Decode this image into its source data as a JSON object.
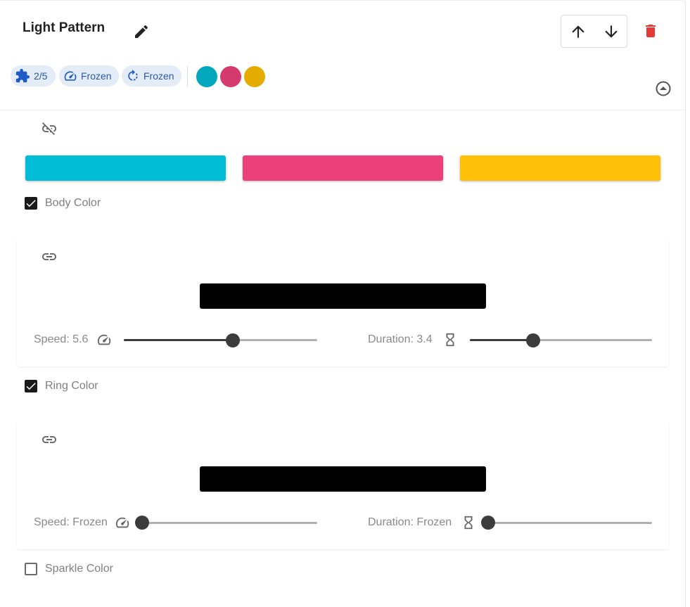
{
  "header": {
    "title": "Light Pattern"
  },
  "chips": [
    {
      "icon": "puzzle-icon",
      "label": "2/5"
    },
    {
      "icon": "speedometer-icon",
      "label": "Frozen"
    },
    {
      "icon": "rotate-icon",
      "label": "Frozen"
    }
  ],
  "palette": {
    "dots": [
      "#00a8be",
      "#d43a6e",
      "#e5ac00"
    ],
    "bars": [
      "#00bcd4",
      "#ec407a",
      "#ffc107"
    ]
  },
  "sections": [
    {
      "label": "Body Color",
      "checked": true,
      "speed_label": "Speed: 5.6",
      "speed_value": 5.6,
      "duration_label": "Duration: 3.4",
      "duration_value": 3.4
    },
    {
      "label": "Ring Color",
      "checked": true,
      "speed_label": "Speed: Frozen",
      "duration_label": "Duration: Frozen"
    },
    {
      "label": "Sparkle Color",
      "checked": false
    }
  ],
  "colors": {
    "chip_bg": "#e4ecf8",
    "chip_text": "#2a5aa8",
    "delete": "#e53935",
    "slider_active": "#3c3c3c",
    "slider_track": "#b0b0b0"
  }
}
